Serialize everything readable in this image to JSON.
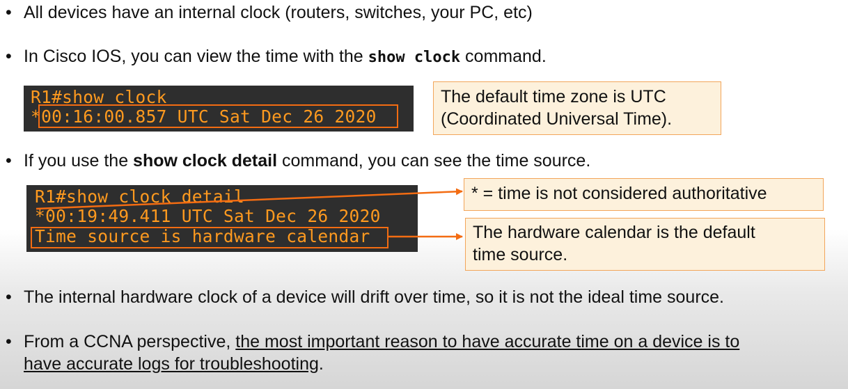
{
  "bullets": {
    "b1": {
      "text": "All devices have an internal clock (routers, switches, your PC, etc)"
    },
    "b2": {
      "pre": "In Cisco IOS, you can view the time with the ",
      "cmd": "show clock",
      "post": " command."
    },
    "b3": {
      "pre": "If you use the ",
      "cmd": "show clock detail",
      "post": " command, you can see the time source."
    },
    "b4": {
      "text": "The internal hardware clock of a device will drift over time, so it is not the ideal time source."
    },
    "b5": {
      "pre": "From a CCNA perspective, ",
      "u1": "the most important reason to have accurate time on a device is to",
      "u2": "have accurate logs for troubleshooting",
      "post": "."
    }
  },
  "bullet_symbol": "•",
  "terminal1": {
    "line1": "R1#show clock",
    "line2_star": "*",
    "line2": "00:16:00.857 UTC Sat Dec 26 2020"
  },
  "terminal2": {
    "line1": "R1#show clock detail",
    "line2_star": "*",
    "line2": "00:19:49.411 UTC Sat Dec 26 2020",
    "line3": "Time source is hardware calendar"
  },
  "notes": {
    "n1_l1": "The default time zone is UTC",
    "n1_l2": "(Coordinated Universal Time).",
    "n2": "* = time is not considered authoritative",
    "n3_l1": "The hardware calendar is the default",
    "n3_l2": "time source."
  },
  "colors": {
    "accent": "#f36c12",
    "terminal_bg": "#2e2e2e",
    "terminal_text": "#ff9a1f",
    "note_bg": "#fdf1dc"
  }
}
